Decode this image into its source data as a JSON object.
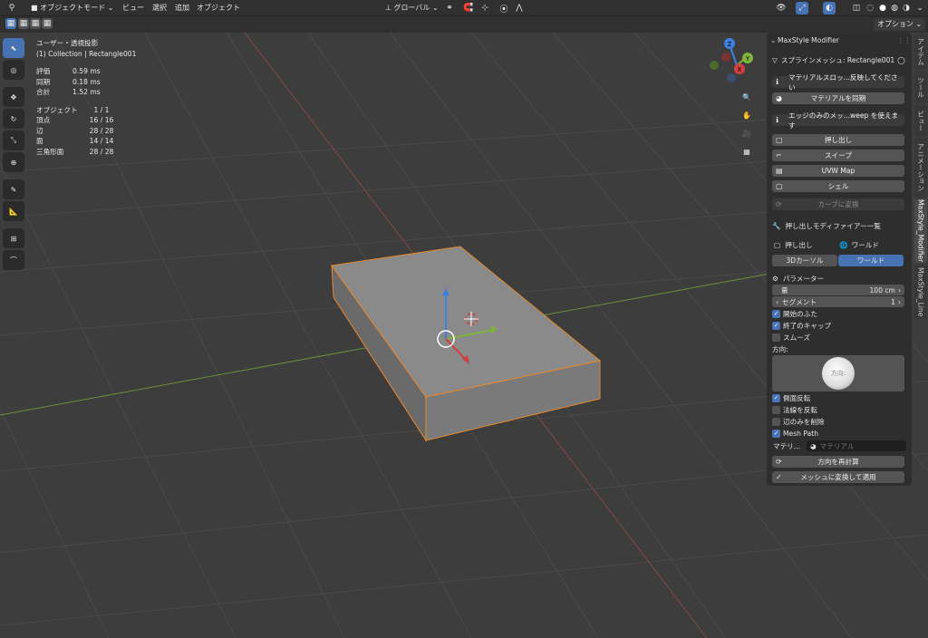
{
  "header": {
    "mode_label": "オブジェクトモード",
    "menu": [
      "ビュー",
      "選択",
      "追加",
      "オブジェクト"
    ],
    "transform_orientation": "グローバル",
    "options_label": "オプション"
  },
  "viewport_info": {
    "view_title": "ユーザー・透視投影",
    "collection_line": "(1) Collection | Rectangle001",
    "timing": [
      {
        "label": "評価",
        "value": "0.59 ms"
      },
      {
        "label": "同期",
        "value": "0.18 ms"
      },
      {
        "label": "合計",
        "value": "1.52 ms"
      }
    ],
    "stats": [
      {
        "label": "オブジェクト",
        "value": "1 / 1"
      },
      {
        "label": "頂点",
        "value": "16 / 16"
      },
      {
        "label": "辺",
        "value": "28 / 28"
      },
      {
        "label": "面",
        "value": "14 / 14"
      },
      {
        "label": "三角形面",
        "value": "28 / 28"
      }
    ]
  },
  "gizmo": {
    "x": "X",
    "y": "Y",
    "z": "Z"
  },
  "panel": {
    "title": "MaxStyle Modifier",
    "spline_mesh": "スプラインメッシュ: Rectangle001",
    "material_notice": "マテリアルスロッ...反映してください",
    "sync_material": "マテリアルを同期",
    "edge_notice": "エッジのみのメッ...weep を使えます",
    "buttons": [
      "押し出し",
      "スイープ",
      "UVW Map",
      "シェル"
    ],
    "convert_curve": "カーブに変換",
    "list_title": "押し出しモディファイアー一覧",
    "list_item_name": "押し出し",
    "list_item_space": "ワールド",
    "space_options": [
      "3Dカーソル",
      "ワールド"
    ],
    "params_title": "パラメーター",
    "amount_label": "量",
    "amount_value": "100 cm",
    "segments_label": "セグメント",
    "segments_value": "1",
    "checks1": [
      {
        "label": "開始のふた",
        "checked": true
      },
      {
        "label": "終了のキャップ",
        "checked": true
      },
      {
        "label": "スムーズ",
        "checked": false
      }
    ],
    "direction_label": "方向:",
    "direction_ball": "方向:",
    "checks2": [
      {
        "label": "側面反転",
        "checked": true
      },
      {
        "label": "法線を反転",
        "checked": false
      },
      {
        "label": "辺のみを削除",
        "checked": false
      },
      {
        "label": "Mesh Path",
        "checked": true
      }
    ],
    "material_label": "マテリ...",
    "material_placeholder": "マテリアル",
    "recalc_direction": "方向を再計算",
    "convert_apply": "メッシュに変換して適用"
  },
  "tabs": [
    "アイテム",
    "ツール",
    "ビュー",
    "アニメーション",
    "MaxStyle_Modifier",
    "MaxStyle_Line"
  ],
  "colors": {
    "accent": "#4772b3",
    "selection": "#e8882a",
    "x_axis": "#c0504d",
    "y_axis": "#7fb33c",
    "z_axis": "#3f7fe0"
  }
}
